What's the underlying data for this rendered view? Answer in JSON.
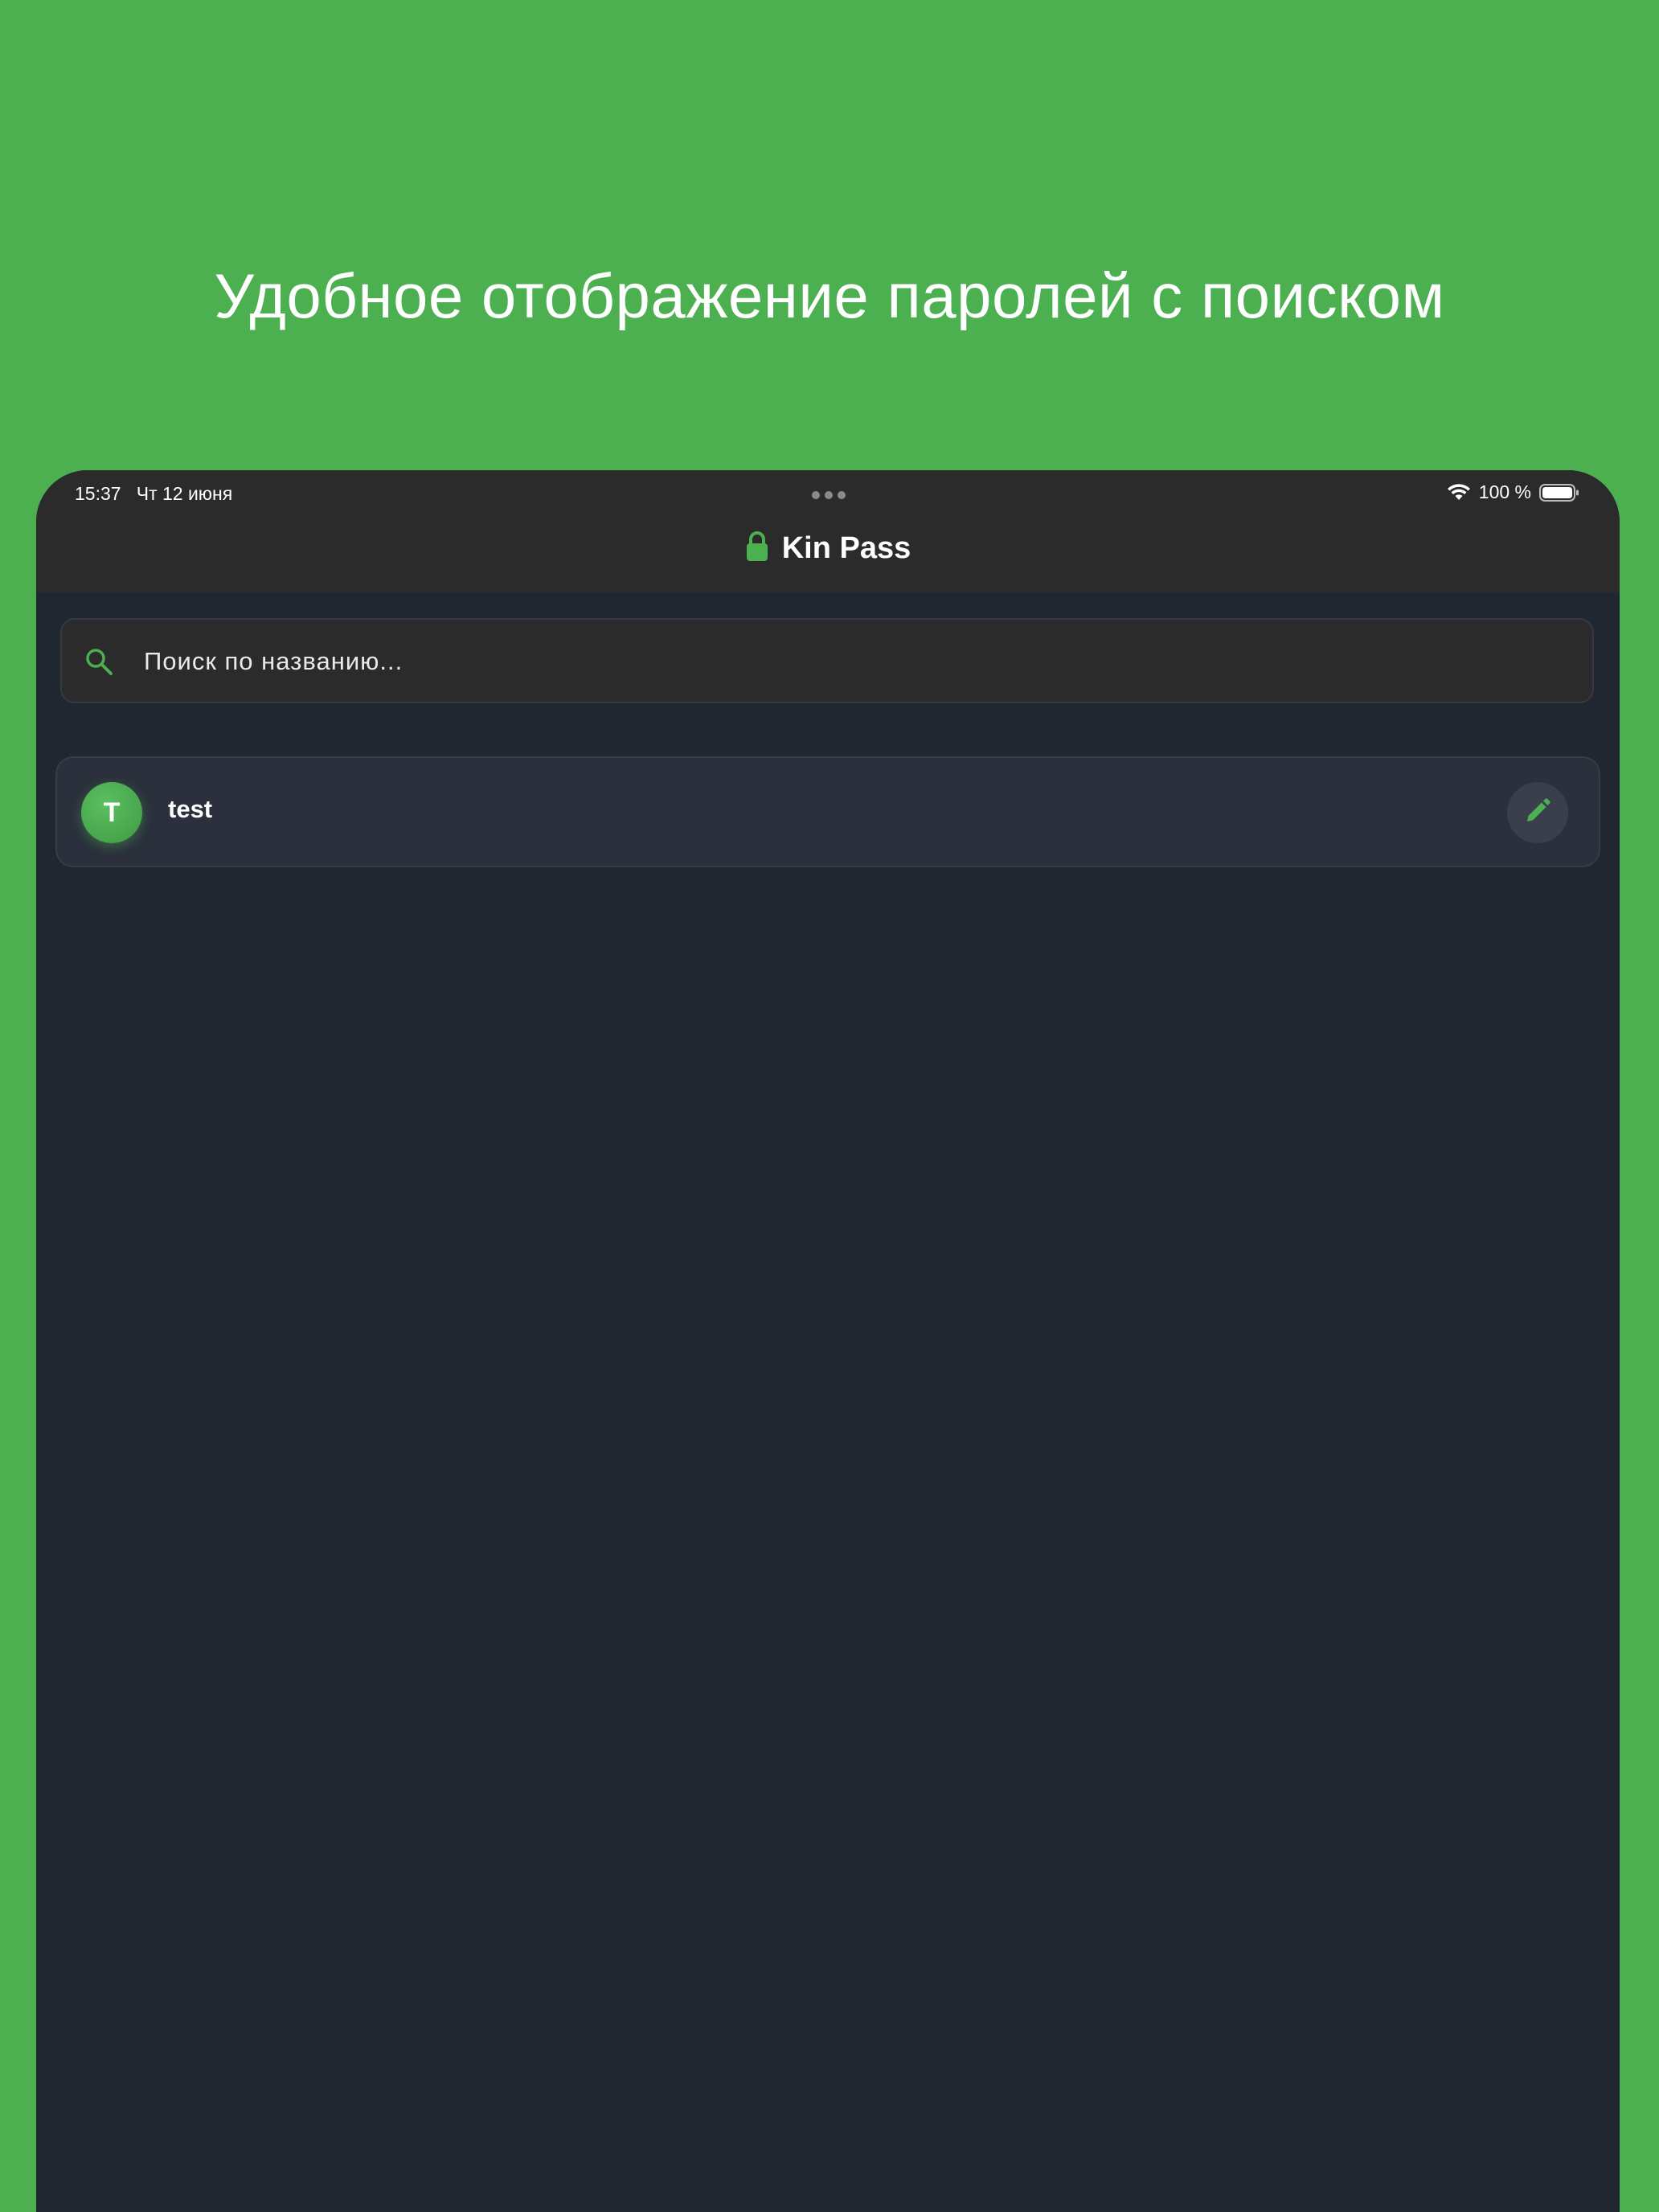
{
  "promo": {
    "headline": "Удобное отображение паролей с поиском"
  },
  "status_bar": {
    "time": "15:37",
    "date": "Чт 12 июня",
    "battery": "100 %"
  },
  "header": {
    "title": "Kin Pass",
    "icon": "lock-icon"
  },
  "search": {
    "placeholder": "Поиск по названию...",
    "value": "",
    "icon": "search-icon"
  },
  "entries": [
    {
      "initial": "T",
      "title": "test",
      "action_icon": "pencil-icon"
    }
  ],
  "colors": {
    "background": "#4caf50",
    "accent": "#4caf50",
    "app_background": "#212731",
    "toolbar": "#2b2b2b",
    "card": "#2b303c"
  }
}
